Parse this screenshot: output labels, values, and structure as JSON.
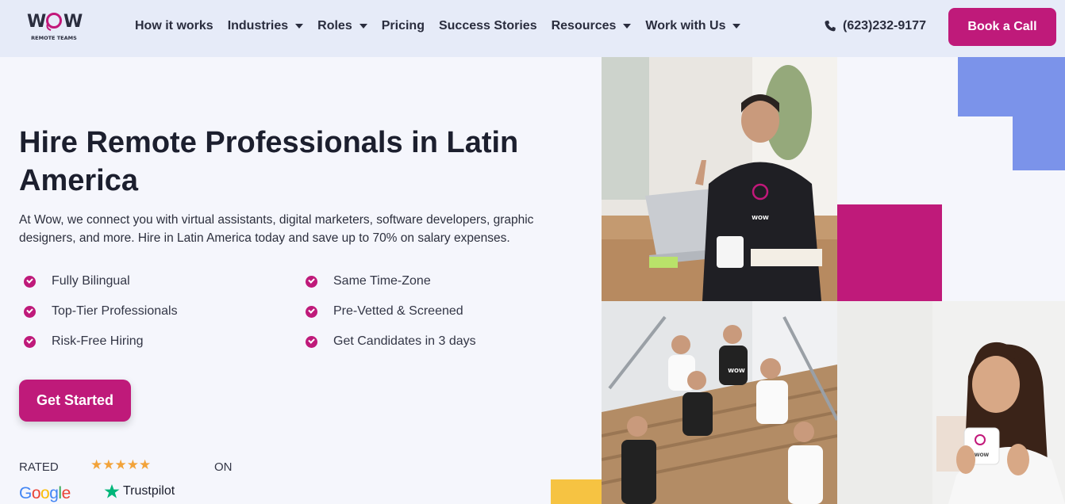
{
  "header": {
    "logo_text": "WOW",
    "logo_subtext": "REMOTE TEAMS",
    "nav": [
      {
        "label": "How it works",
        "dropdown": false
      },
      {
        "label": "Industries",
        "dropdown": true
      },
      {
        "label": "Roles",
        "dropdown": true
      },
      {
        "label": "Pricing",
        "dropdown": false
      },
      {
        "label": "Success Stories",
        "dropdown": false
      },
      {
        "label": "Resources",
        "dropdown": true
      },
      {
        "label": "Work with Us",
        "dropdown": true
      }
    ],
    "phone": "(623)232-9177",
    "book_label": "Book a Call"
  },
  "hero": {
    "title": "Hire Remote Professionals in Latin America",
    "description": "At Wow, we connect you with virtual assistants, digital marketers, software developers, graphic designers, and more. Hire in Latin America today and save up to 70% on salary expenses.",
    "features_left": [
      "Fully Bilingual",
      "Top-Tier Professionals",
      "Risk-Free Hiring"
    ],
    "features_right": [
      "Same Time-Zone",
      "Pre-Vetted & Screened",
      "Get Candidates in 3 days"
    ],
    "cta_label": "Get Started",
    "rated_label": "RATED",
    "on_label": "ON",
    "stars": "★★★★★",
    "google_label": "Google",
    "trustpilot_label": "Trustpilot"
  },
  "colors": {
    "brand": "#bf1a7a",
    "header_bg": "#e6ebf8",
    "page_bg": "#f5f6fc",
    "accent_blue": "#7b93ea",
    "accent_yellow": "#f6c342",
    "star": "#f2a33a",
    "trustpilot_green": "#00b67a"
  },
  "icons": {
    "phone": "phone-icon",
    "check": "check-circle-icon",
    "caret": "chevron-down-icon",
    "trustpilot": "trustpilot-star-icon"
  },
  "images": [
    {
      "name": "photo-man-waving-laptop",
      "badge": "WOW"
    },
    {
      "name": "photo-team-on-stairs",
      "badge": "WOW"
    },
    {
      "name": "photo-woman-with-mug",
      "badge": "WOW"
    }
  ]
}
